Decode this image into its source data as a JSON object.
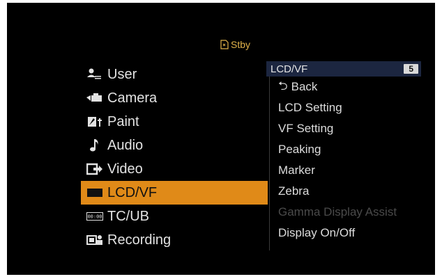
{
  "status": {
    "text": "Stby",
    "icon": "card-icon"
  },
  "menu": {
    "items": [
      {
        "label": "User",
        "icon": "user-icon"
      },
      {
        "label": "Camera",
        "icon": "camera-icon"
      },
      {
        "label": "Paint",
        "icon": "paint-icon"
      },
      {
        "label": "Audio",
        "icon": "audio-icon"
      },
      {
        "label": "Video",
        "icon": "video-icon"
      },
      {
        "label": "LCD/VF",
        "icon": "lcd-vf-icon",
        "selected": true
      },
      {
        "label": "TC/UB",
        "icon": "tc-ub-icon"
      },
      {
        "label": "Recording",
        "icon": "recording-icon"
      }
    ]
  },
  "submenu": {
    "title": "LCD/VF",
    "page": "5",
    "items": [
      {
        "label": "Back",
        "icon": "back-arrow-icon"
      },
      {
        "label": "LCD Setting"
      },
      {
        "label": "VF Setting"
      },
      {
        "label": "Peaking"
      },
      {
        "label": "Marker"
      },
      {
        "label": "Zebra"
      },
      {
        "label": "Gamma Display Assist",
        "disabled": true
      },
      {
        "label": "Display On/Off"
      }
    ]
  },
  "colors": {
    "highlight": "#e08a18",
    "header": "#1c2640",
    "status": "#e0b24a"
  }
}
